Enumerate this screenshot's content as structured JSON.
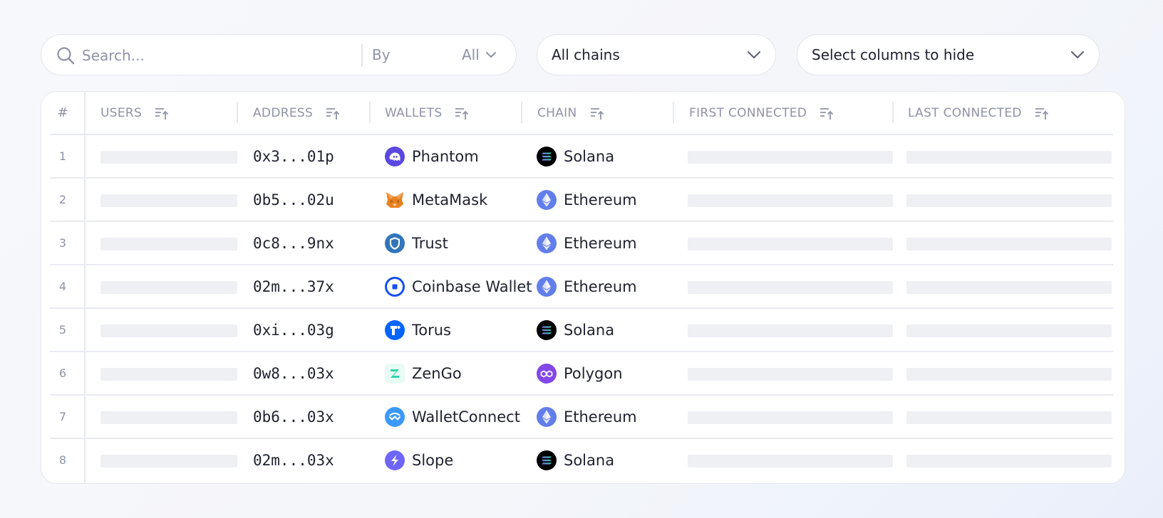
{
  "search": {
    "placeholder": "Search...",
    "by_label": "By",
    "by_value": "All"
  },
  "chain_filter": {
    "value": "All chains"
  },
  "columns_filter": {
    "value": "Select columns to hide"
  },
  "table": {
    "headers": {
      "num": "#",
      "users": "USERS",
      "address": "ADDRESS",
      "wallets": "WALLETS",
      "chain": "CHAIN",
      "first_connected": "FIRST CONNECTED",
      "last_connected": "LAST CONNECTED"
    },
    "rows": [
      {
        "num": "1",
        "address": "0x3...01p",
        "wallet": "Phantom",
        "wallet_icon": "phantom-icon",
        "chain": "Solana",
        "chain_icon": "solana-icon"
      },
      {
        "num": "2",
        "address": "0b5...02u",
        "wallet": "MetaMask",
        "wallet_icon": "metamask-icon",
        "chain": "Ethereum",
        "chain_icon": "ethereum-icon"
      },
      {
        "num": "3",
        "address": "0c8...9nx",
        "wallet": "Trust",
        "wallet_icon": "trust-icon",
        "chain": "Ethereum",
        "chain_icon": "ethereum-icon"
      },
      {
        "num": "4",
        "address": "02m...37x",
        "wallet": "Coinbase Wallet",
        "wallet_icon": "coinbase-icon",
        "chain": "Ethereum",
        "chain_icon": "ethereum-icon"
      },
      {
        "num": "5",
        "address": "0xi...03g",
        "wallet": "Torus",
        "wallet_icon": "torus-icon",
        "chain": "Solana",
        "chain_icon": "solana-icon"
      },
      {
        "num": "6",
        "address": "0w8...03x",
        "wallet": "ZenGo",
        "wallet_icon": "zengo-icon",
        "chain": "Polygon",
        "chain_icon": "polygon-icon"
      },
      {
        "num": "7",
        "address": "0b6...03x",
        "wallet": "WalletConnect",
        "wallet_icon": "walletconnect-icon",
        "chain": "Ethereum",
        "chain_icon": "ethereum-icon"
      },
      {
        "num": "8",
        "address": "02m...03x",
        "wallet": "Slope",
        "wallet_icon": "slope-icon",
        "chain": "Solana",
        "chain_icon": "solana-icon"
      }
    ]
  },
  "colors": {
    "text": "#20232f",
    "muted": "#8e93a6",
    "border": "#e6e8ef",
    "skeleton": "#eff0f4",
    "phantom": "#5b48e0",
    "metamask": "#e8821e",
    "trust": "#3375bb",
    "coinbase": "#1652f0",
    "torus": "#0364ff",
    "zengo": "#30d5a9",
    "walletconnect": "#3b99fc",
    "slope": "#6e66fa",
    "ethereum": "#627eea",
    "polygon": "#8247e5",
    "solana": "#000000"
  }
}
